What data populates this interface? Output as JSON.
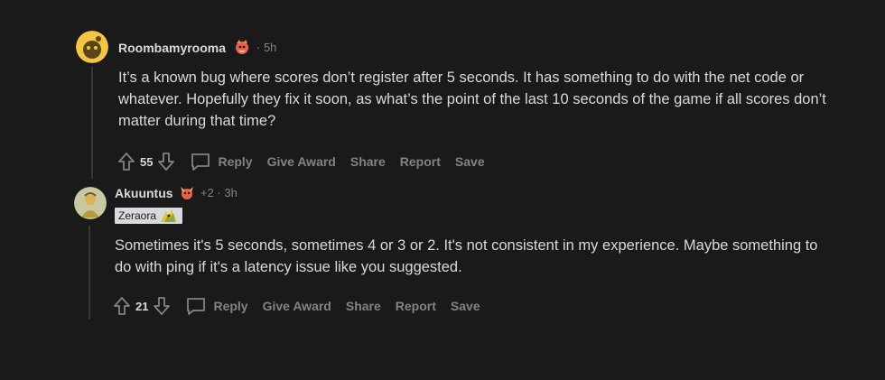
{
  "comments": [
    {
      "username": "Roombamyrooma",
      "flair_icon": "flame-pokemon-icon",
      "time": "· 5h",
      "body": "It’s a known bug where scores don’t register after 5 seconds. It has something to do with the net code or whatever. Hopefully they fix it soon, as what’s the point of the last 10 seconds of the game if all scores don’t matter during that time?",
      "score": "55",
      "actions": {
        "reply": "Reply",
        "give_award": "Give Award",
        "share": "Share",
        "report": "Report",
        "save": "Save"
      }
    },
    {
      "username": "Akuuntus",
      "flair_icon": "pokemon-icon",
      "time": "+2 · 3h",
      "user_flair": "Zeraora",
      "body": "Sometimes it's 5 seconds, sometimes 4 or 3 or 2. It's not consistent in my experience. Maybe something to do with ping if it's a latency issue like you suggested.",
      "score": "21",
      "actions": {
        "reply": "Reply",
        "give_award": "Give Award",
        "share": "Share",
        "report": "Report",
        "save": "Save"
      }
    }
  ],
  "colors": {
    "background": "#1a1a1b",
    "text": "#d7dadc",
    "muted": "#818384",
    "thread_line": "#343536"
  }
}
